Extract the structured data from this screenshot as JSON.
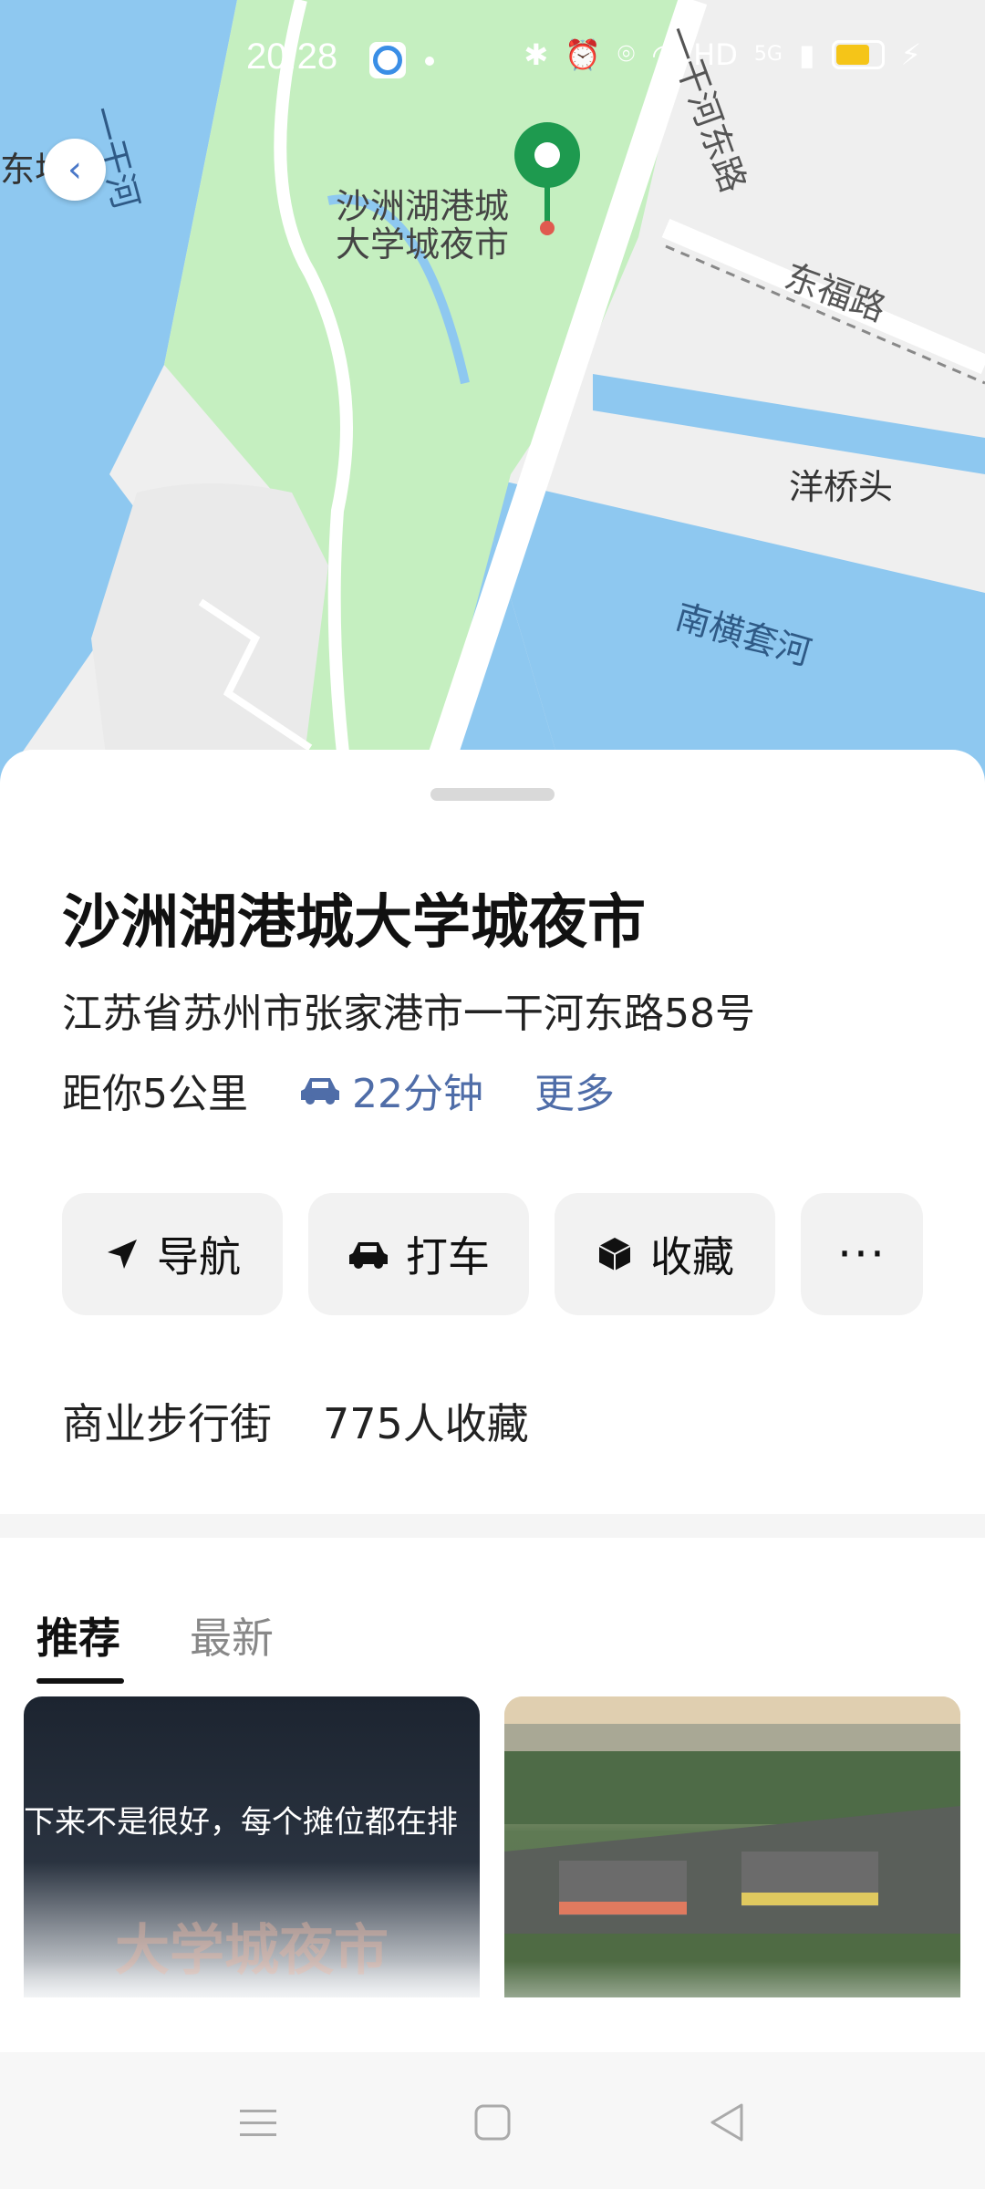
{
  "status_bar": {
    "time": "20:28",
    "network": "HD",
    "signal": "5G"
  },
  "map": {
    "labels": {
      "river_west": "一干河",
      "road_east": "一干河东路",
      "road_dongfu": "东福路",
      "place_yangqiaotou": "洋桥头",
      "river_nanheng": "南横套河",
      "left_edge": "东埭",
      "poi_marker_line1": "沙洲湖港城",
      "poi_marker_line2": "大学城夜市"
    },
    "colors": {
      "water": "#8ec8f0",
      "park": "#c5efc0",
      "land": "#efefef",
      "marker": "#1e9a4f"
    }
  },
  "poi": {
    "name": "沙洲湖港城大学城夜市",
    "address": "江苏省苏州市张家港市一干河东路58号",
    "distance": "距你5公里",
    "drive_time": "22分钟",
    "more_link": "更多",
    "category": "商业步行街",
    "favorites": "775人收藏"
  },
  "actions": {
    "navigate": "导航",
    "taxi": "打车",
    "favorite": "收藏",
    "more": "···"
  },
  "tabs": {
    "recommended": "推荐",
    "latest": "最新"
  },
  "cards": {
    "card1_caption": "下来不是很好，每个摊位都在排",
    "card1_overlay": "大学城夜市"
  }
}
